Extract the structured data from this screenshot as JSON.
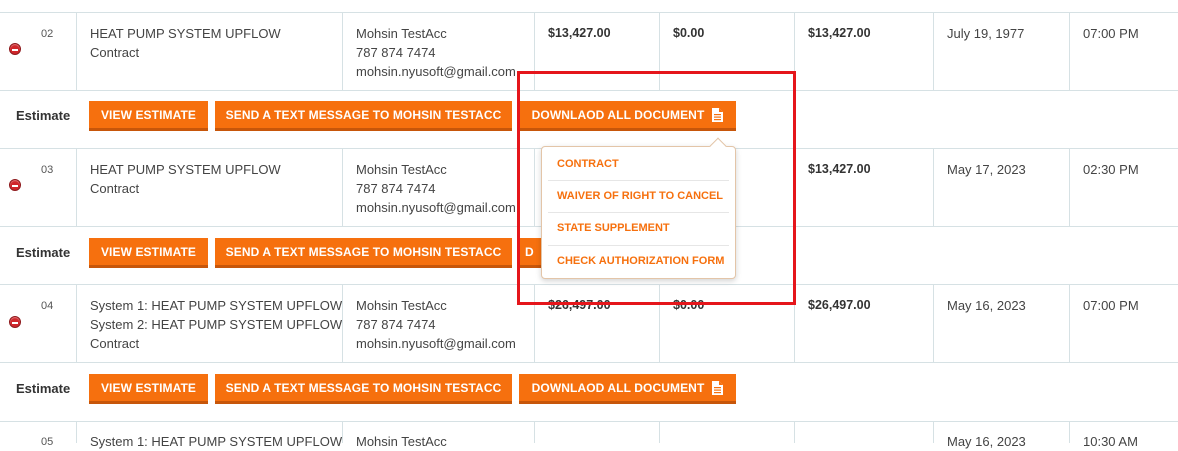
{
  "rows": [
    {
      "num": "02",
      "system_lines": [
        "HEAT PUMP SYSTEM UPFLOW",
        "Contract"
      ],
      "customer": {
        "name": "Mohsin TestAcc",
        "phone": "787 874 7474",
        "email": "mohsin.nyusoft@gmail.com"
      },
      "amount": "$13,427.00",
      "paid": "$0.00",
      "total": "$13,427.00",
      "date": "July 19, 1977",
      "time": "07:00 PM"
    },
    {
      "num": "03",
      "system_lines": [
        "HEAT PUMP SYSTEM UPFLOW",
        "Contract"
      ],
      "customer": {
        "name": "Mohsin TestAcc",
        "phone": "787 874 7474",
        "email": "mohsin.nyusoft@gmail.com"
      },
      "total": "$13,427.00",
      "date": "May 17, 2023",
      "time": "02:30 PM"
    },
    {
      "num": "04",
      "system_lines": [
        "System 1: HEAT PUMP SYSTEM UPFLOW",
        "System 2: HEAT PUMP SYSTEM UPFLOW",
        "Contract"
      ],
      "customer": {
        "name": "Mohsin TestAcc",
        "phone": "787 874 7474",
        "email": "mohsin.nyusoft@gmail.com"
      },
      "amount": "$26,497.00",
      "paid": "$0.00",
      "total": "$26,497.00",
      "date": "May 16, 2023",
      "time": "07:00 PM"
    },
    {
      "num": "05",
      "system_lines": [
        "System 1: HEAT PUMP SYSTEM UPFLOW"
      ],
      "customer": {
        "name": "Mohsin TestAcc"
      },
      "date": "May 16, 2023",
      "time": "10:30 AM"
    }
  ],
  "estimate_bar": {
    "label": "Estimate",
    "view_estimate": "VIEW ESTIMATE",
    "send_text": "SEND A TEXT MESSAGE TO MOHSIN TESTACC",
    "download_all": "DOWNLAOD ALL DOCUMENT",
    "download_partial": "D"
  },
  "dropdown": {
    "items": [
      "CONTRACT",
      "WAIVER OF RIGHT TO CANCEL",
      "STATE SUPPLEMENT",
      "CHECK AUTHORIZATION FORM"
    ]
  },
  "colors": {
    "accent": "#f6700e",
    "highlight": "#e5161b",
    "remove": "#d0262b",
    "grid": "#d6e1e4"
  },
  "icons": {
    "remove": "minus-circle-icon",
    "document": "document-icon"
  }
}
